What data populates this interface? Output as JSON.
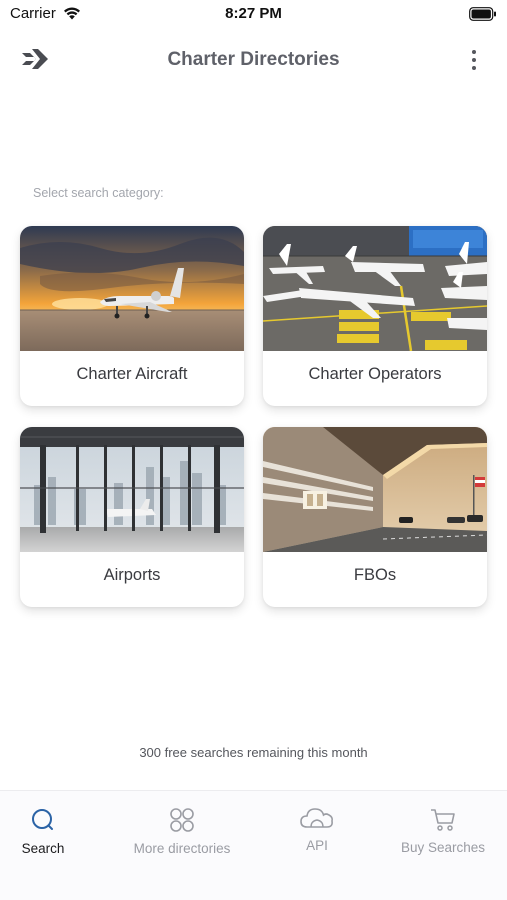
{
  "status_bar": {
    "carrier": "Carrier",
    "time": "8:27 PM",
    "icons": [
      "wifi-icon",
      "battery-icon"
    ]
  },
  "nav": {
    "title": "Charter Directories",
    "logo_icon": "jet-logo-icon",
    "menu_icon": "more-vertical-icon"
  },
  "main": {
    "section_label": "Select search category:",
    "categories": [
      {
        "label": "Charter Aircraft",
        "image": "private-jet-at-sunset-photo"
      },
      {
        "label": "Charter Operators",
        "image": "jets-on-apron-photo"
      },
      {
        "label": "Airports",
        "image": "airport-terminal-window-photo"
      },
      {
        "label": "FBOs",
        "image": "fbo-terminal-building-photo"
      }
    ],
    "remaining_text": "300 free searches remaining this month"
  },
  "tab_bar": {
    "tabs": [
      {
        "label": "Search",
        "icon": "search-icon",
        "active": true
      },
      {
        "label": "More directories",
        "icon": "grid-circles-icon",
        "active": false
      },
      {
        "label": "API",
        "icon": "cloud-icon",
        "active": false
      },
      {
        "label": "Buy Searches",
        "icon": "cart-icon",
        "active": false
      }
    ]
  },
  "colors": {
    "accent": "#2b63a6",
    "title_gray": "#5f6169",
    "label_gray": "#a3a6ad"
  }
}
